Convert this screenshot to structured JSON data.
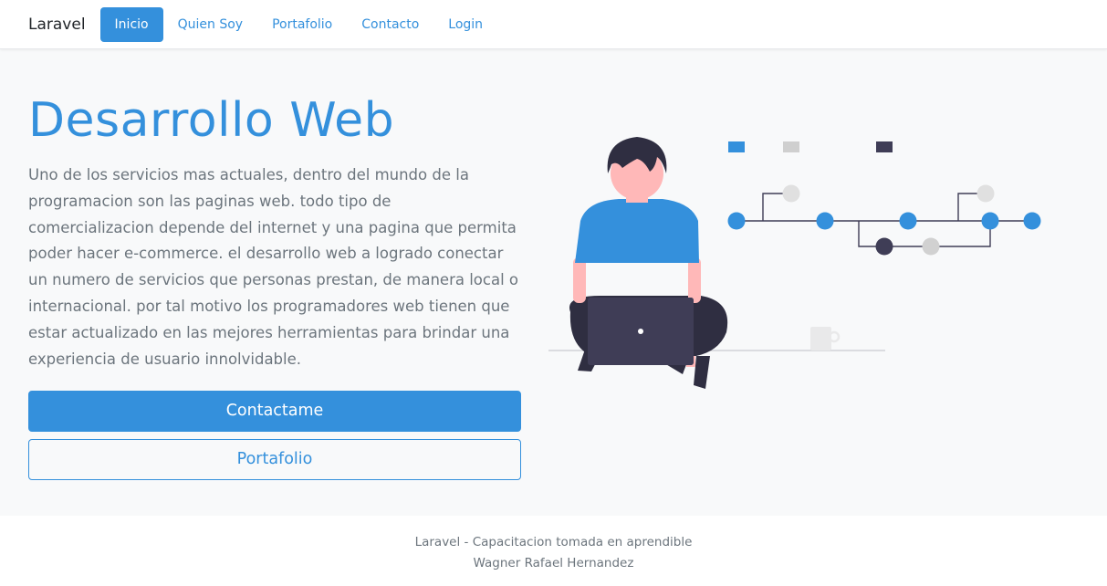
{
  "navbar": {
    "brand": "Laravel",
    "items": [
      {
        "label": "Inicio",
        "active": true
      },
      {
        "label": "Quien Soy",
        "active": false
      },
      {
        "label": "Portafolio",
        "active": false
      },
      {
        "label": "Contacto",
        "active": false
      },
      {
        "label": "Login",
        "active": false
      }
    ]
  },
  "hero": {
    "title": "Desarrollo Web",
    "description": "Uno de los servicios mas actuales, dentro del mundo de la programacion son las paginas web. todo tipo de comercializacion depende del internet y una pagina que permita poder hacer e-commerce. el desarrollo web a logrado conectar un numero de servicios que personas prestan, de manera local o internacional. por tal motivo los programadores web tienen que estar actualizado en las mejores herramientas para brindar una experiencia de usuario innolvidable.",
    "primary_button": "Contactame",
    "secondary_button": "Portafolio",
    "illustration_icon": "developer-laptop-illustration"
  },
  "footer": {
    "line1": "Laravel - Capacitacion tomada en aprendible",
    "line2": "Wagner Rafael Hernandez"
  },
  "colors": {
    "primary": "#3490dc",
    "background": "#f8f9fa",
    "text": "#6c757d",
    "dark": "#3f3d56",
    "skin": "#ffb8b8"
  }
}
